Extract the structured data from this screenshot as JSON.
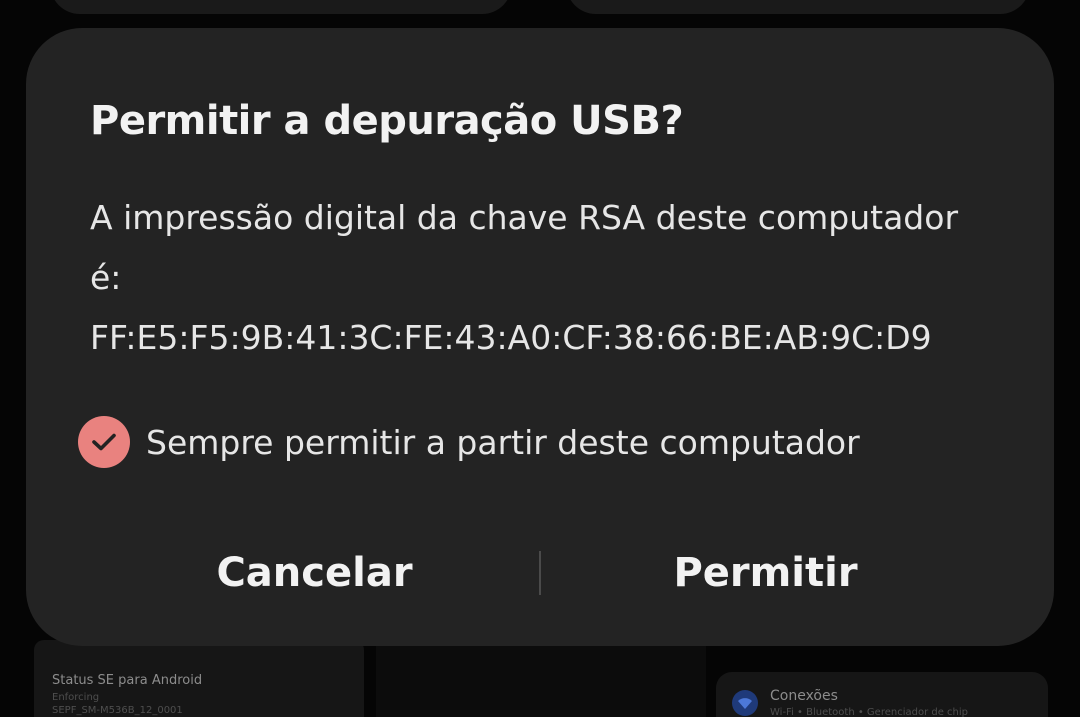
{
  "dialog": {
    "title": "Permitir a depuração USB?",
    "message_line1": "A impressão digital da chave RSA deste computador",
    "message_line2": "é:",
    "fingerprint": "FF:E5:F5:9B:41:3C:FE:43:A0:CF:38:66:BE:AB:9C:D9",
    "checkbox_label": "Sempre permitir a partir deste computador",
    "checkbox_checked": true,
    "cancel_label": "Cancelar",
    "allow_label": "Permitir",
    "checkbox_color": "#e9827f",
    "background_color": "#232323"
  },
  "background": {
    "status_card": {
      "title": "Status SE para Android",
      "line1": "Enforcing",
      "line2": "SEPF_SM-M536B_12_0001"
    },
    "connections_card": {
      "icon": "wifi-icon",
      "title": "Conexões",
      "subtitle": "Wi-Fi • Bluetooth • Gerenciador de chip"
    }
  }
}
